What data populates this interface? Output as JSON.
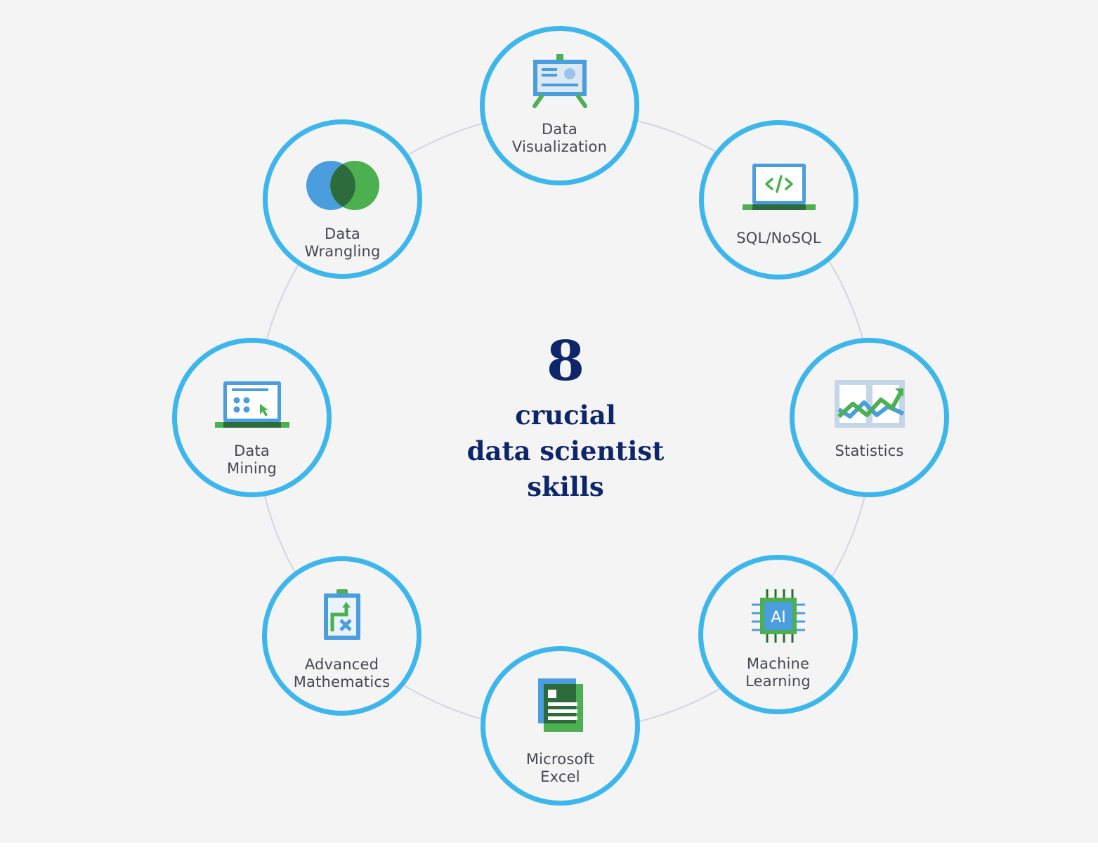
{
  "center": {
    "number": "8",
    "text": "crucial\ndata scientist\nskills"
  },
  "colors": {
    "ring": "#3db6ec",
    "connector": "#d3d5e3",
    "title": "#0d2669",
    "label": "#46484f",
    "icon_blue": "#4a9ede",
    "icon_green": "#4caf50",
    "icon_dark_green": "#2e6b3c"
  },
  "skills": [
    {
      "label": "Data\nVisualization",
      "icon": "presentation-board-icon"
    },
    {
      "label": "SQL/NoSQL",
      "icon": "laptop-code-icon"
    },
    {
      "label": "Statistics",
      "icon": "line-chart-icon"
    },
    {
      "label": "Machine\nLearning",
      "icon": "ai-chip-icon"
    },
    {
      "label": "Microsoft\nExcel",
      "icon": "spreadsheet-document-icon"
    },
    {
      "label": "Advanced\nMathematics",
      "icon": "math-clipboard-icon"
    },
    {
      "label": "Data\nMining",
      "icon": "laptop-dots-cursor-icon"
    },
    {
      "label": "Data\nWrangling",
      "icon": "venn-diagram-icon"
    }
  ]
}
